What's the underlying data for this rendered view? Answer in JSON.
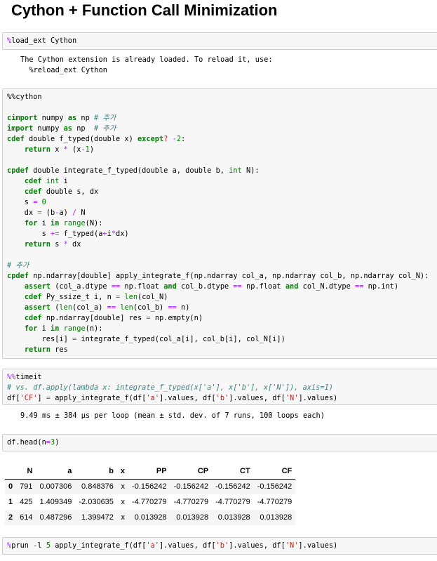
{
  "title": "Cython + Function Call Minimization",
  "cells": [
    {
      "lines": [
        [
          [
            "%",
            "m"
          ],
          [
            "load_ext Cython",
            ""
          ]
        ]
      ]
    },
    {
      "lines": [
        [
          [
            "%%cython",
            ""
          ]
        ],
        [],
        [
          [
            "cimport",
            "k"
          ],
          [
            " numpy ",
            ""
          ],
          [
            "as",
            "k"
          ],
          [
            " np ",
            ""
          ],
          [
            "# 추가",
            "c"
          ]
        ],
        [
          [
            "import",
            "k"
          ],
          [
            " numpy ",
            ""
          ],
          [
            "as",
            "k"
          ],
          [
            " np  ",
            ""
          ],
          [
            "# 추가",
            "c"
          ]
        ],
        [
          [
            "cdef",
            "k"
          ],
          [
            " double f_typed(double x) ",
            ""
          ],
          [
            "except",
            "k"
          ],
          [
            "?",
            "e"
          ],
          [
            " ",
            ""
          ],
          [
            "-",
            "o"
          ],
          [
            "2",
            "n"
          ],
          [
            ":",
            ""
          ]
        ],
        [
          [
            "    ",
            ""
          ],
          [
            "return",
            "k"
          ],
          [
            " x ",
            ""
          ],
          [
            "*",
            "o"
          ],
          [
            " (x",
            ""
          ],
          [
            "-",
            "o"
          ],
          [
            "1",
            "n"
          ],
          [
            ")",
            ""
          ]
        ],
        [],
        [
          [
            "cpdef",
            "k"
          ],
          [
            " double integrate_f_typed(double a, double b, ",
            ""
          ],
          [
            "int",
            "b"
          ],
          [
            " N):",
            ""
          ]
        ],
        [
          [
            "    ",
            ""
          ],
          [
            "cdef",
            "k"
          ],
          [
            " ",
            ""
          ],
          [
            "int",
            "b"
          ],
          [
            " i",
            ""
          ]
        ],
        [
          [
            "    ",
            ""
          ],
          [
            "cdef",
            "k"
          ],
          [
            " double s, dx",
            ""
          ]
        ],
        [
          [
            "    s ",
            ""
          ],
          [
            "=",
            "o"
          ],
          [
            " ",
            ""
          ],
          [
            "0",
            "n"
          ]
        ],
        [
          [
            "    dx ",
            ""
          ],
          [
            "=",
            "o"
          ],
          [
            " (b",
            ""
          ],
          [
            "-",
            "o"
          ],
          [
            "a) ",
            ""
          ],
          [
            "/",
            "o"
          ],
          [
            " N",
            ""
          ]
        ],
        [
          [
            "    ",
            ""
          ],
          [
            "for",
            "k"
          ],
          [
            " i ",
            ""
          ],
          [
            "in",
            "k"
          ],
          [
            " ",
            ""
          ],
          [
            "range",
            "b"
          ],
          [
            "(N):",
            ""
          ]
        ],
        [
          [
            "        s ",
            ""
          ],
          [
            "+=",
            "o"
          ],
          [
            " f_typed(a",
            ""
          ],
          [
            "+",
            "o"
          ],
          [
            "i",
            ""
          ],
          [
            "*",
            "o"
          ],
          [
            "dx)",
            ""
          ]
        ],
        [
          [
            "    ",
            ""
          ],
          [
            "return",
            "k"
          ],
          [
            " s ",
            ""
          ],
          [
            "*",
            "o"
          ],
          [
            " dx",
            ""
          ]
        ],
        [],
        [
          [
            "# 추가",
            "c"
          ]
        ],
        [
          [
            "cpdef",
            "k"
          ],
          [
            " np.ndarray[double] apply_integrate_f(np.ndarray col_a, np.ndarray col_b, np.ndarray col_N):",
            ""
          ]
        ],
        [
          [
            "    ",
            ""
          ],
          [
            "assert",
            "k"
          ],
          [
            " (col_a.dtype ",
            ""
          ],
          [
            "==",
            "o"
          ],
          [
            " np.float ",
            ""
          ],
          [
            "and",
            "k"
          ],
          [
            " col_b.dtype ",
            ""
          ],
          [
            "==",
            "o"
          ],
          [
            " np.float ",
            ""
          ],
          [
            "and",
            "k"
          ],
          [
            " col_N.dtype ",
            ""
          ],
          [
            "==",
            "o"
          ],
          [
            " np.int)",
            ""
          ]
        ],
        [
          [
            "    ",
            ""
          ],
          [
            "cdef",
            "k"
          ],
          [
            " Py_ssize_t i, n ",
            ""
          ],
          [
            "=",
            "o"
          ],
          [
            " ",
            ""
          ],
          [
            "len",
            "b"
          ],
          [
            "(col_N)",
            ""
          ]
        ],
        [
          [
            "    ",
            ""
          ],
          [
            "assert",
            "k"
          ],
          [
            " (",
            ""
          ],
          [
            "len",
            "b"
          ],
          [
            "(col_a) ",
            ""
          ],
          [
            "==",
            "o"
          ],
          [
            " ",
            ""
          ],
          [
            "len",
            "b"
          ],
          [
            "(col_b) ",
            ""
          ],
          [
            "==",
            "o"
          ],
          [
            " n)",
            ""
          ]
        ],
        [
          [
            "    ",
            ""
          ],
          [
            "cdef",
            "k"
          ],
          [
            " np.ndarray[double] res ",
            ""
          ],
          [
            "=",
            "o"
          ],
          [
            " np.empty(n)",
            ""
          ]
        ],
        [
          [
            "    ",
            ""
          ],
          [
            "for",
            "k"
          ],
          [
            " i ",
            ""
          ],
          [
            "in",
            "k"
          ],
          [
            " ",
            ""
          ],
          [
            "range",
            "b"
          ],
          [
            "(n):",
            ""
          ]
        ],
        [
          [
            "        res[i] ",
            ""
          ],
          [
            "=",
            "o"
          ],
          [
            " integrate_f_typed(col_a[i], col_b[i], col_N[i])",
            ""
          ]
        ],
        [
          [
            "    ",
            ""
          ],
          [
            "return",
            "k"
          ],
          [
            " res",
            ""
          ]
        ]
      ]
    },
    {
      "lines": [
        [
          [
            "%%",
            "m"
          ],
          [
            "timeit",
            ""
          ]
        ],
        [
          [
            "# vs. df.apply(lambda x: integrate_f_typed(x['a'], x['b'], x['N']), axis=1)",
            "c"
          ]
        ],
        [
          [
            "df[",
            ""
          ],
          [
            "'CF'",
            "s"
          ],
          [
            "] ",
            ""
          ],
          [
            "=",
            "o"
          ],
          [
            " apply_integrate_f(df[",
            ""
          ],
          [
            "'a'",
            "s"
          ],
          [
            "].values, df[",
            ""
          ],
          [
            "'b'",
            "s"
          ],
          [
            "].values, df[",
            ""
          ],
          [
            "'N'",
            "s"
          ],
          [
            "].values)",
            ""
          ]
        ]
      ]
    },
    {
      "lines": [
        [
          [
            "df.head(n",
            ""
          ],
          [
            "=",
            "o"
          ],
          [
            "3",
            "n"
          ],
          [
            ")",
            ""
          ]
        ]
      ]
    },
    {
      "lines": [
        [
          [
            "%",
            "m"
          ],
          [
            "prun ",
            ""
          ],
          [
            "-",
            "o"
          ],
          [
            "l ",
            ""
          ],
          [
            "5",
            "n"
          ],
          [
            " apply_integrate_f(df[",
            ""
          ],
          [
            "'a'",
            "s"
          ],
          [
            "].values, df[",
            ""
          ],
          [
            "'b'",
            "s"
          ],
          [
            "].values, df[",
            ""
          ],
          [
            "'N'",
            "s"
          ],
          [
            "].values)",
            ""
          ]
        ]
      ]
    }
  ],
  "outputs": {
    "load_ext": "The Cython extension is already loaded. To reload it, use:\n  %reload_ext Cython",
    "timeit": "9.49 ms ± 384 µs per loop (mean ± std. dev. of 7 runs, 100 loops each)"
  },
  "table": {
    "columns": [
      "",
      "N",
      "a",
      "b",
      "x",
      "PP",
      "CP",
      "CT",
      "CF"
    ],
    "rows": [
      [
        "0",
        "791",
        "0.007306",
        "0.848376",
        "x",
        "-0.156242",
        "-0.156242",
        "-0.156242",
        "-0.156242"
      ],
      [
        "1",
        "425",
        "1.409349",
        "-2.030635",
        "x",
        "-4.770279",
        "-4.770279",
        "-4.770279",
        "-4.770279"
      ],
      [
        "2",
        "614",
        "0.487296",
        "1.399472",
        "x",
        "0.013928",
        "0.013928",
        "0.013928",
        "0.013928"
      ]
    ]
  }
}
